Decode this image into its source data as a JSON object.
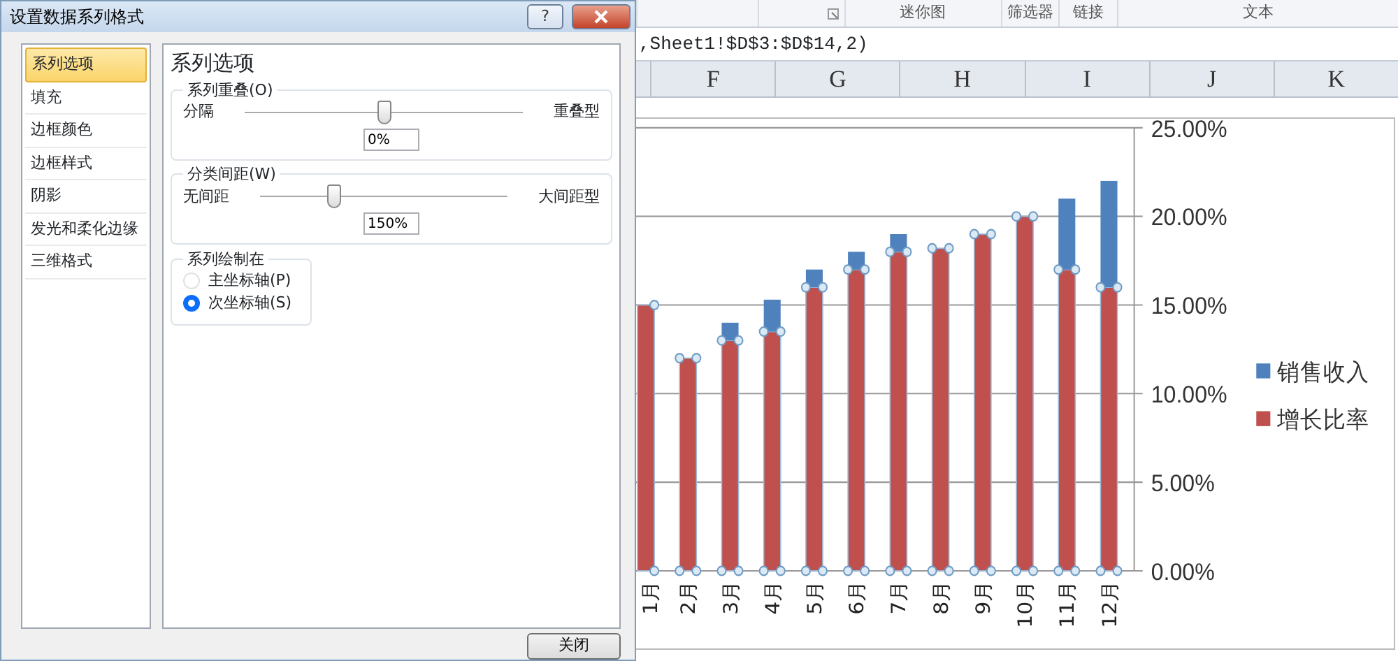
{
  "dialog": {
    "title": "设置数据系列格式",
    "help_label": "?",
    "nav_items": [
      {
        "label": "系列选项",
        "selected": true
      },
      {
        "label": "填充",
        "selected": false
      },
      {
        "label": "边框颜色",
        "selected": false
      },
      {
        "label": "边框样式",
        "selected": false
      },
      {
        "label": "阴影",
        "selected": false
      },
      {
        "label": "发光和柔化边缘",
        "selected": false
      },
      {
        "label": "三维格式",
        "selected": false
      }
    ],
    "heading": "系列选项",
    "sliders": [
      {
        "legend": "系列重叠(O)",
        "left_label": "分隔",
        "right_label": "重叠型",
        "level": 0.5,
        "value": "0%"
      },
      {
        "legend": "分类间距(W)",
        "left_label": "无间距",
        "right_label": "大间距型",
        "level": 0.3,
        "value": "150%"
      }
    ],
    "axis_group": {
      "legend": "系列绘制在",
      "options": [
        {
          "label": "主坐标轴(P)",
          "selected": false
        },
        {
          "label": "次坐标轴(S)",
          "selected": true
        }
      ]
    },
    "close_button": "关闭"
  },
  "ribbon_groups": [
    "迷你图",
    "筛选器",
    "链接",
    "文本"
  ],
  "formula": ",Sheet1!$D$3:$D$14,2)",
  "columns": [
    "F",
    "G",
    "H",
    "I",
    "J",
    "K"
  ],
  "chart": {
    "series_selection": [
      {
        "selected": true
      },
      {
        "selected": false
      }
    ],
    "chart_data": {
      "type": "bar",
      "orientation": "vertical",
      "categories": [
        "1月",
        "2月",
        "3月",
        "4月",
        "5月",
        "6月",
        "7月",
        "8月",
        "9月",
        "10月",
        "11月",
        "12月"
      ],
      "stacked": true,
      "grid": {
        "y": true
      },
      "legend": true,
      "series": [
        {
          "name": "增长比率",
          "color": "#c0504d",
          "values": [
            15,
            12,
            13,
            13.5,
            16,
            17,
            18,
            18.2,
            19,
            20,
            17,
            16
          ]
        },
        {
          "name": "销售收入",
          "color": "#4f81bd",
          "values": [
            null,
            null,
            1,
            1.8,
            1,
            1,
            1,
            null,
            null,
            null,
            4,
            6
          ]
        }
      ],
      "ylim": [
        0,
        25
      ],
      "yticks": [
        {
          "value": 0,
          "label": "0.00%"
        },
        {
          "value": 5,
          "label": "5.00%"
        },
        {
          "value": 10,
          "label": "10.00%"
        },
        {
          "value": 15,
          "label": "15.00%"
        },
        {
          "value": 20,
          "label": "20.00%"
        },
        {
          "value": 25,
          "label": "25.00%"
        }
      ]
    }
  }
}
